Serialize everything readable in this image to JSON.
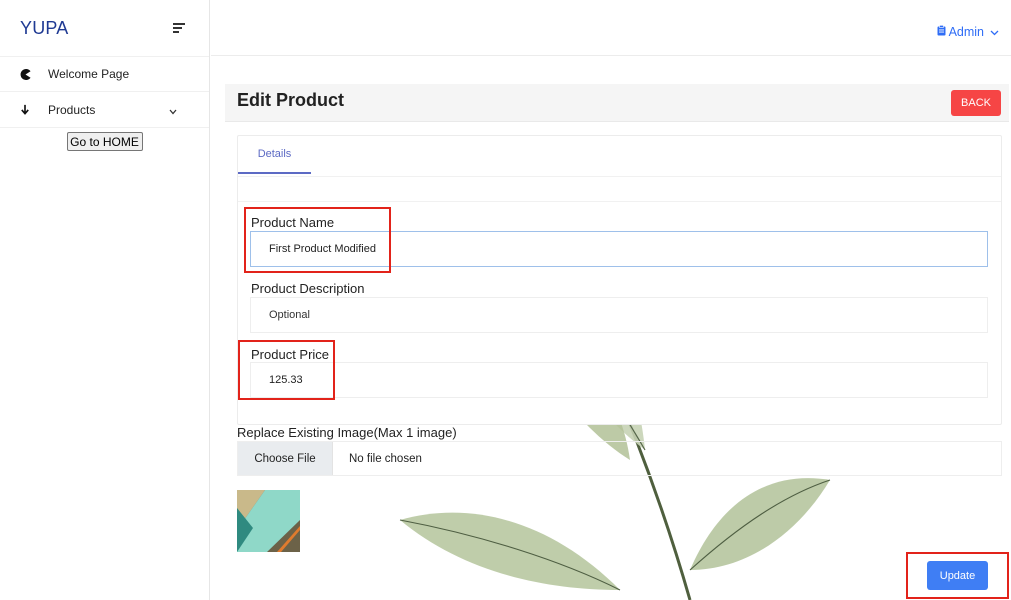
{
  "sidebar": {
    "brand": "YUPA",
    "items": [
      {
        "label": "Welcome Page",
        "icon": "pacman-icon"
      },
      {
        "label": "Products",
        "icon": "down-arrow-icon"
      }
    ],
    "home_button": "Go to HOME"
  },
  "topbar": {
    "user": "Admin"
  },
  "header": {
    "title": "Edit Product",
    "back_label": "BACK"
  },
  "tabs": [
    {
      "label": "Details",
      "active": true
    }
  ],
  "form": {
    "name": {
      "label": "Product Name",
      "value": "First Product Modified"
    },
    "description": {
      "label": "Product Description",
      "placeholder": "Optional"
    },
    "price": {
      "label": "Product Price",
      "value": "125.33"
    },
    "image": {
      "label": "Replace Existing Image(Max 1 image)",
      "choose_label": "Choose File",
      "status": "No file chosen"
    }
  },
  "update_label": "Update",
  "colors": {
    "brand": "#1f3a93",
    "accent": "#3f7ef4",
    "danger": "#f64545",
    "tab": "#5c6ac4",
    "highlight": "#e2231a"
  }
}
